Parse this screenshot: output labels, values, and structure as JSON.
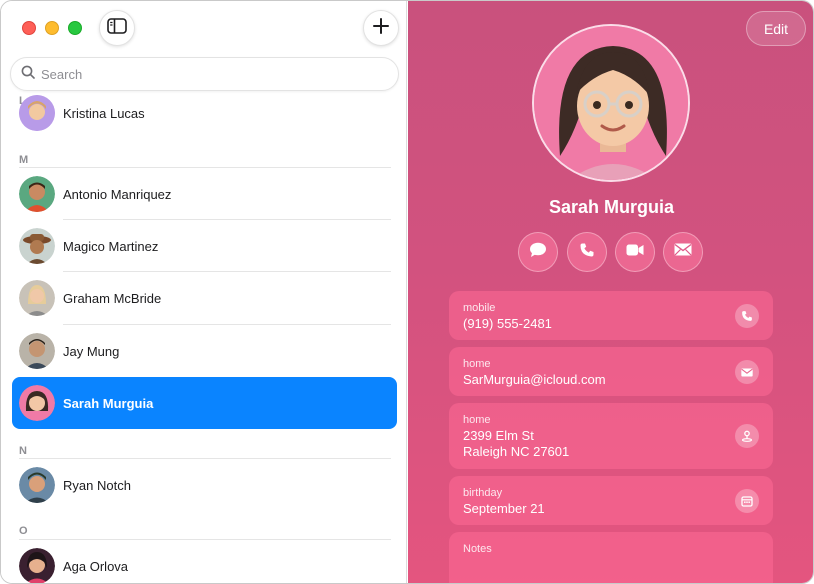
{
  "search": {
    "placeholder": "Search"
  },
  "contacts": {
    "sections": [
      {
        "letter": "L"
      },
      {
        "letter": "M"
      },
      {
        "letter": "N"
      },
      {
        "letter": "O"
      }
    ],
    "rows": [
      {
        "name": "Kristina Lucas",
        "selected": false
      },
      {
        "name": "Antonio Manriquez",
        "selected": false
      },
      {
        "name": "Magico Martinez",
        "selected": false
      },
      {
        "name": "Graham McBride",
        "selected": false
      },
      {
        "name": "Jay Mung",
        "selected": false
      },
      {
        "name": "Sarah Murguia",
        "selected": true
      },
      {
        "name": "Ryan Notch",
        "selected": false
      },
      {
        "name": "Aga Orlova",
        "selected": false
      }
    ]
  },
  "detail": {
    "edit_label": "Edit",
    "name": "Sarah Murguia",
    "actions": [
      "message-icon",
      "phone-icon",
      "video-icon",
      "mail-icon"
    ],
    "fields": [
      {
        "label": "mobile",
        "value": "(919) 555-2481",
        "icon": "phone-icon"
      },
      {
        "label": "home",
        "value": "SarMurguia@icloud.com",
        "icon": "mail-icon"
      },
      {
        "label": "home",
        "value_line1": "2399 Elm St",
        "value_line2": "Raleigh NC 27601",
        "icon": "map-pin-icon"
      },
      {
        "label": "birthday",
        "value": "September 21",
        "icon": "calendar-icon"
      },
      {
        "label": "Notes"
      }
    ]
  },
  "colors": {
    "accent": "#0a84ff",
    "detail_background": "#d2527f",
    "traffic_red": "#fe5f57",
    "traffic_yellow": "#febc2e",
    "traffic_green": "#28c840"
  }
}
